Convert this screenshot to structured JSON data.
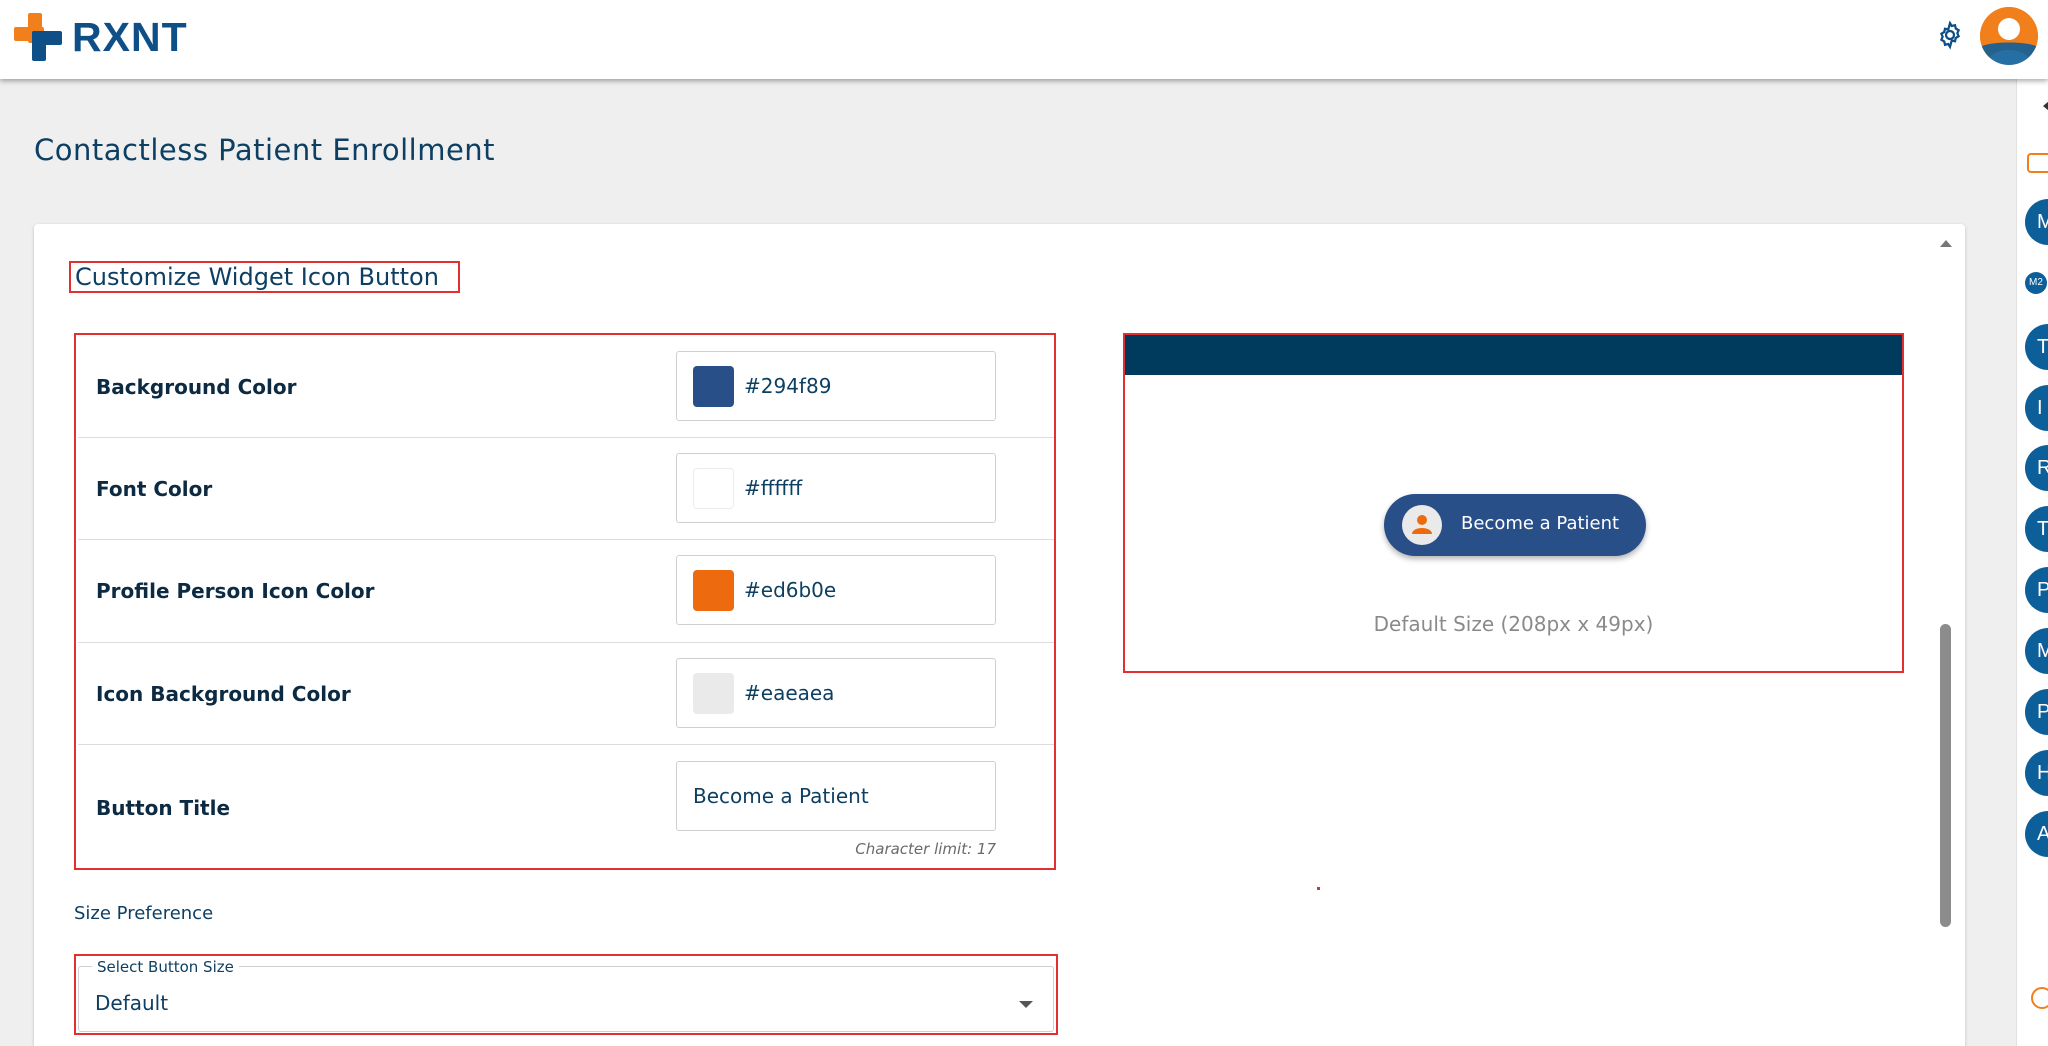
{
  "app": {
    "brand": "RXNT"
  },
  "header": {
    "settings_icon": "gear-icon",
    "avatar_icon": "user-avatar-icon"
  },
  "rail": {
    "items": [
      "M",
      "M2",
      "T",
      "I",
      "R",
      "T",
      "P",
      "M",
      "P",
      "H",
      "A"
    ]
  },
  "page": {
    "title": "Contactless Patient Enrollment"
  },
  "section": {
    "title": "Customize Widget Icon Button"
  },
  "settings": {
    "rows": [
      {
        "label": "Background Color",
        "value": "#294f89",
        "swatch": "#294f89"
      },
      {
        "label": "Font Color",
        "value": "#ffffff",
        "swatch": "#ffffff"
      },
      {
        "label": "Profile Person Icon Color",
        "value": "#ed6b0e",
        "swatch": "#ed6b0e"
      },
      {
        "label": "Icon Background Color",
        "value": "#eaeaea",
        "swatch": "#eaeaea"
      }
    ],
    "button_title": {
      "label": "Button Title",
      "value": "Become a Patient",
      "limit": "Character limit: 17"
    }
  },
  "preview": {
    "button_text": "Become a Patient",
    "caption": "Default Size (208px x 49px)",
    "bar_color": "#003a5c"
  },
  "size": {
    "heading": "Size Preference",
    "select_label": "Select Button Size",
    "select_value": "Default"
  }
}
